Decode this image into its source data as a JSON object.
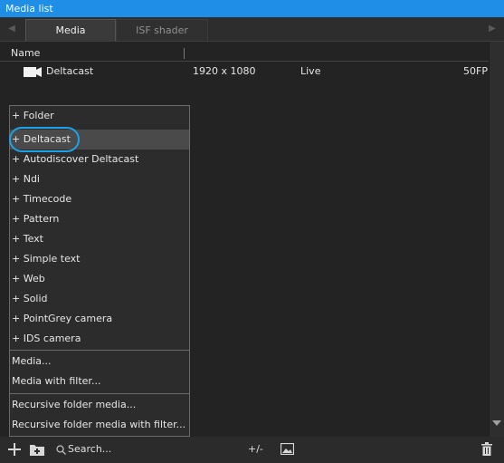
{
  "window": {
    "title": "Media list"
  },
  "tabs": [
    {
      "label": "Media",
      "active": true
    },
    {
      "label": "ISF shader",
      "active": false
    }
  ],
  "table": {
    "columns": [
      "Name"
    ],
    "rows": [
      {
        "name": "Deltacast",
        "resolution": "1920 x 1080",
        "status": "Live",
        "fps": "50FP"
      }
    ]
  },
  "menu": {
    "add_items": [
      "+ Folder",
      "+ Deltacast",
      "+ Autodiscover Deltacast",
      "+ Ndi",
      "+ Timecode",
      "+ Pattern",
      "+ Text",
      "+ Simple text",
      "+ Web",
      "+ Solid",
      "+ PointGrey camera",
      "+ IDS camera"
    ],
    "media_items": [
      "Media...",
      "Media with filter..."
    ],
    "recursive_items": [
      "Recursive folder media...",
      "Recursive folder media with filter..."
    ],
    "highlighted_index": 1
  },
  "bottom": {
    "search_placeholder": "Search...",
    "plus_minus": "+/-"
  },
  "colors": {
    "title_bar": "#1e8ee6",
    "highlight_ring": "#1aa3ea"
  },
  "icons": [
    "camera-icon",
    "plus-icon",
    "add-folder-icon",
    "search-icon",
    "image-icon",
    "trash-icon",
    "arrow-left-icon",
    "arrow-right-icon",
    "scroll-down-icon"
  ]
}
